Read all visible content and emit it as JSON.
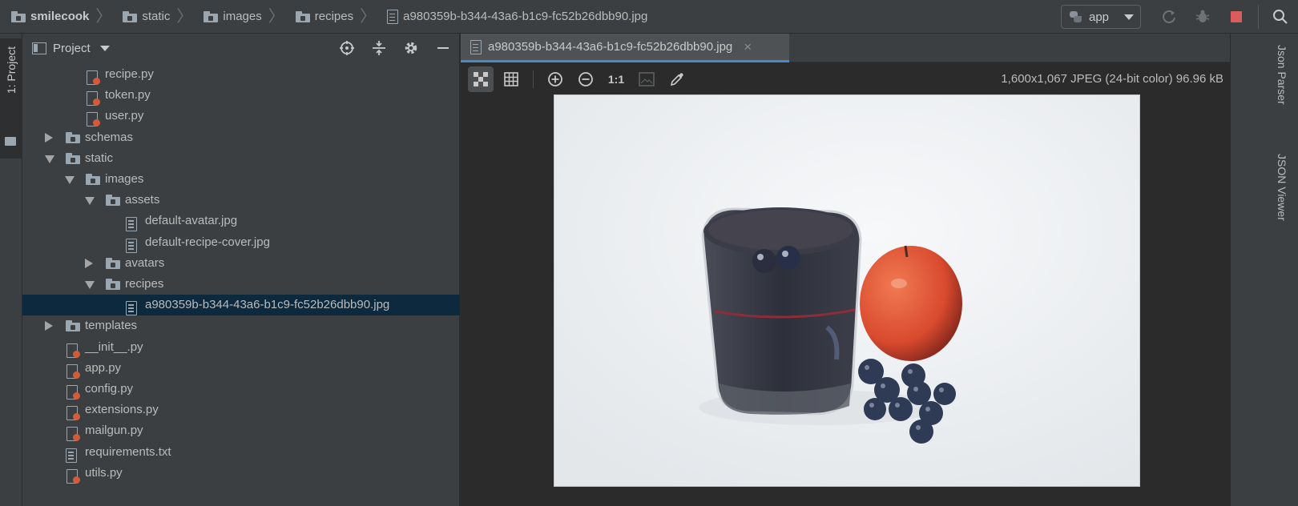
{
  "breadcrumbs": [
    {
      "label": "smilecook",
      "icon": "folder-icon"
    },
    {
      "label": "static",
      "icon": "folder-icon"
    },
    {
      "label": "images",
      "icon": "folder-icon"
    },
    {
      "label": "recipes",
      "icon": "folder-icon"
    },
    {
      "label": "a980359b-b344-43a6-b1c9-fc52b26dbb90.jpg",
      "icon": "image-file-icon"
    }
  ],
  "run_config": {
    "label": "app"
  },
  "left_strip": {
    "project_tool": "1: Project"
  },
  "project_panel": {
    "title": "Project",
    "tree": [
      {
        "label": "recipe.py",
        "icon": "python-file-icon",
        "depth": 3,
        "expander": "none"
      },
      {
        "label": "token.py",
        "icon": "python-file-icon",
        "depth": 3,
        "expander": "none"
      },
      {
        "label": "user.py",
        "icon": "python-file-icon",
        "depth": 3,
        "expander": "none"
      },
      {
        "label": "schemas",
        "icon": "folder-icon",
        "depth": 2,
        "expander": "collapsed"
      },
      {
        "label": "static",
        "icon": "folder-icon",
        "depth": 2,
        "expander": "expanded"
      },
      {
        "label": "images",
        "icon": "folder-icon",
        "depth": 3,
        "expander": "expanded"
      },
      {
        "label": "assets",
        "icon": "folder-icon",
        "depth": 4,
        "expander": "expanded"
      },
      {
        "label": "default-avatar.jpg",
        "icon": "image-file-icon",
        "depth": 5,
        "expander": "none"
      },
      {
        "label": "default-recipe-cover.jpg",
        "icon": "image-file-icon",
        "depth": 5,
        "expander": "none"
      },
      {
        "label": "avatars",
        "icon": "folder-icon",
        "depth": 4,
        "expander": "collapsed"
      },
      {
        "label": "recipes",
        "icon": "folder-icon",
        "depth": 4,
        "expander": "expanded"
      },
      {
        "label": "a980359b-b344-43a6-b1c9-fc52b26dbb90.jpg",
        "icon": "image-file-icon",
        "depth": 5,
        "expander": "none",
        "selected": true
      },
      {
        "label": "templates",
        "icon": "folder-icon",
        "depth": 2,
        "expander": "collapsed"
      },
      {
        "label": "__init__.py",
        "icon": "python-file-icon",
        "depth": 2,
        "expander": "none"
      },
      {
        "label": "app.py",
        "icon": "python-file-icon",
        "depth": 2,
        "expander": "none"
      },
      {
        "label": "config.py",
        "icon": "python-file-icon",
        "depth": 2,
        "expander": "none"
      },
      {
        "label": "extensions.py",
        "icon": "python-file-icon",
        "depth": 2,
        "expander": "none"
      },
      {
        "label": "mailgun.py",
        "icon": "python-file-icon",
        "depth": 2,
        "expander": "none"
      },
      {
        "label": "requirements.txt",
        "icon": "text-file-icon",
        "depth": 2,
        "expander": "none"
      },
      {
        "label": "utils.py",
        "icon": "python-file-icon",
        "depth": 2,
        "expander": "none"
      }
    ]
  },
  "editor": {
    "tab_label": "a980359b-b344-43a6-b1c9-fc52b26dbb90.jpg",
    "zoom_label": "1:1",
    "image_info": "1,600x1,067 JPEG (24-bit color) 96.96 kB"
  },
  "right_strip": {
    "tools": [
      "Json Parser",
      "JSON Viewer"
    ]
  },
  "colors": {
    "selection": "#0d293e",
    "accent": "#4a88c7",
    "stop": "#db5c5c",
    "panel": "#3c3f41"
  }
}
